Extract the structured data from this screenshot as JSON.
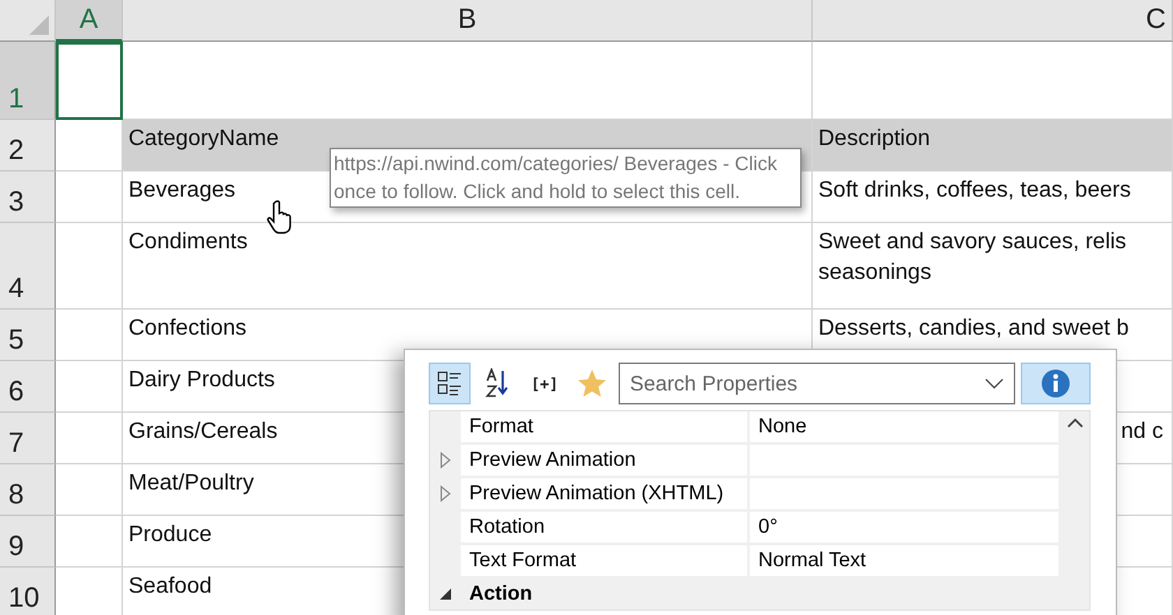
{
  "columns": [
    {
      "label": "A",
      "selected": true
    },
    {
      "label": "B",
      "selected": false
    },
    {
      "label": "C",
      "selected": false
    }
  ],
  "rows": [
    {
      "number": "1",
      "selected": true,
      "header": false
    },
    {
      "number": "2",
      "selected": false,
      "header": true,
      "b": "CategoryName",
      "c": "Description"
    },
    {
      "number": "3",
      "selected": false,
      "header": false,
      "b": "Beverages",
      "c": "Soft drinks, coffees, teas, beers"
    },
    {
      "number": "4",
      "selected": false,
      "header": false,
      "b": "Condiments",
      "c": "Sweet and savory sauces, relis\nseasonings"
    },
    {
      "number": "5",
      "selected": false,
      "header": false,
      "b": "Confections",
      "c": "Desserts, candies, and sweet b"
    },
    {
      "number": "6",
      "selected": false,
      "header": false,
      "b": "Dairy Products"
    },
    {
      "number": "7",
      "selected": false,
      "header": false,
      "b": "Grains/Cereals",
      "c": "nd c",
      "c_clipped": true
    },
    {
      "number": "8",
      "selected": false,
      "header": false,
      "b": "Meat/Poultry"
    },
    {
      "number": "9",
      "selected": false,
      "header": false,
      "b": "Produce"
    },
    {
      "number": "10",
      "selected": false,
      "header": false,
      "b": "Seafood"
    }
  ],
  "tooltip": {
    "text": "https://api.nwind.com/categories/ Beverages - Click once to follow. Click and hold to select this cell."
  },
  "properties_panel": {
    "toolbar": [
      {
        "kind": "categorized",
        "selected": true
      },
      {
        "kind": "alphabetical",
        "selected": false
      },
      {
        "kind": "expression",
        "label": "[+]",
        "selected": false
      },
      {
        "kind": "favorites",
        "selected": false
      }
    ],
    "search": {
      "placeholder": "Search Properties"
    },
    "info_button": {
      "selected": true
    },
    "properties": [
      {
        "name": "Format",
        "value": "None",
        "expandable": false
      },
      {
        "name": "Preview Animation",
        "expandable": true
      },
      {
        "name": "Preview Animation (XHTML)",
        "expandable": true
      },
      {
        "name": "Rotation",
        "value": "0°",
        "expandable": false
      },
      {
        "name": "Text Format",
        "value": "Normal Text",
        "expandable": false
      }
    ],
    "category": {
      "name": "Action",
      "expanded": true
    }
  }
}
